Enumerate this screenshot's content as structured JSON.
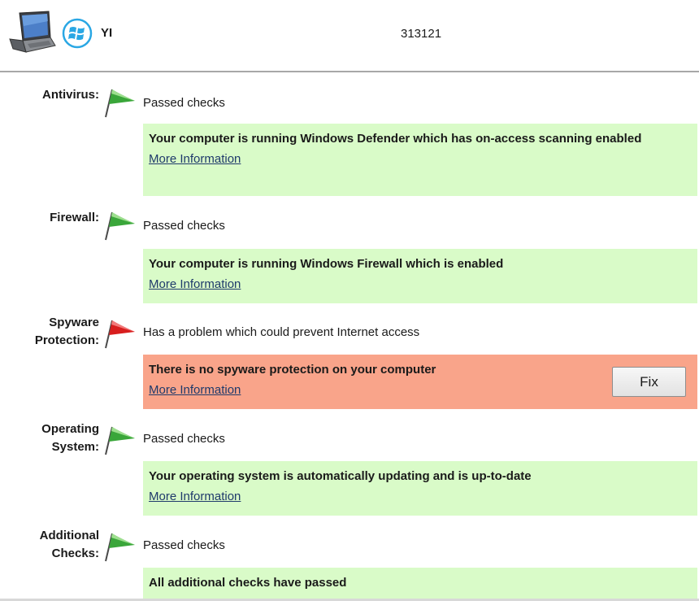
{
  "header": {
    "hostname": "YI",
    "machine_id": "313121"
  },
  "checks": [
    {
      "label_lines": [
        "Antivirus:"
      ],
      "status": "Passed checks",
      "flag_color": "#3aa63a",
      "message": "Your computer is running Windows Defender which has on-access scanning enabled",
      "link": "More Information"
    },
    {
      "label_lines": [
        "Firewall:"
      ],
      "status": "Passed checks",
      "flag_color": "#3aa63a",
      "message": "Your computer is running Windows Firewall which is enabled",
      "link": "More Information"
    },
    {
      "label_lines": [
        "Spyware",
        "Protection:"
      ],
      "status": "Has a problem which could prevent Internet access",
      "flag_color": "#d81e1e",
      "message": "There is no spyware protection on your computer",
      "link": "More Information",
      "fix_label": "Fix"
    },
    {
      "label_lines": [
        "Operating",
        "System:"
      ],
      "status": "Passed checks",
      "flag_color": "#3aa63a",
      "message": "Your operating system is automatically updating and is up-to-date",
      "link": "More Information"
    },
    {
      "label_lines": [
        "Additional",
        "Checks:"
      ],
      "status": "Passed checks",
      "flag_color": "#3aa63a",
      "message": "All additional checks have passed"
    }
  ],
  "colors": {
    "ok_box": "#d9fbc8",
    "problem_box": "#f9a48a",
    "link": "#1f3a6b"
  },
  "icons": {
    "computer": "laptop-icon",
    "os": "windows-logo-icon",
    "passed": "green-flag-icon",
    "problem": "red-flag-icon"
  }
}
